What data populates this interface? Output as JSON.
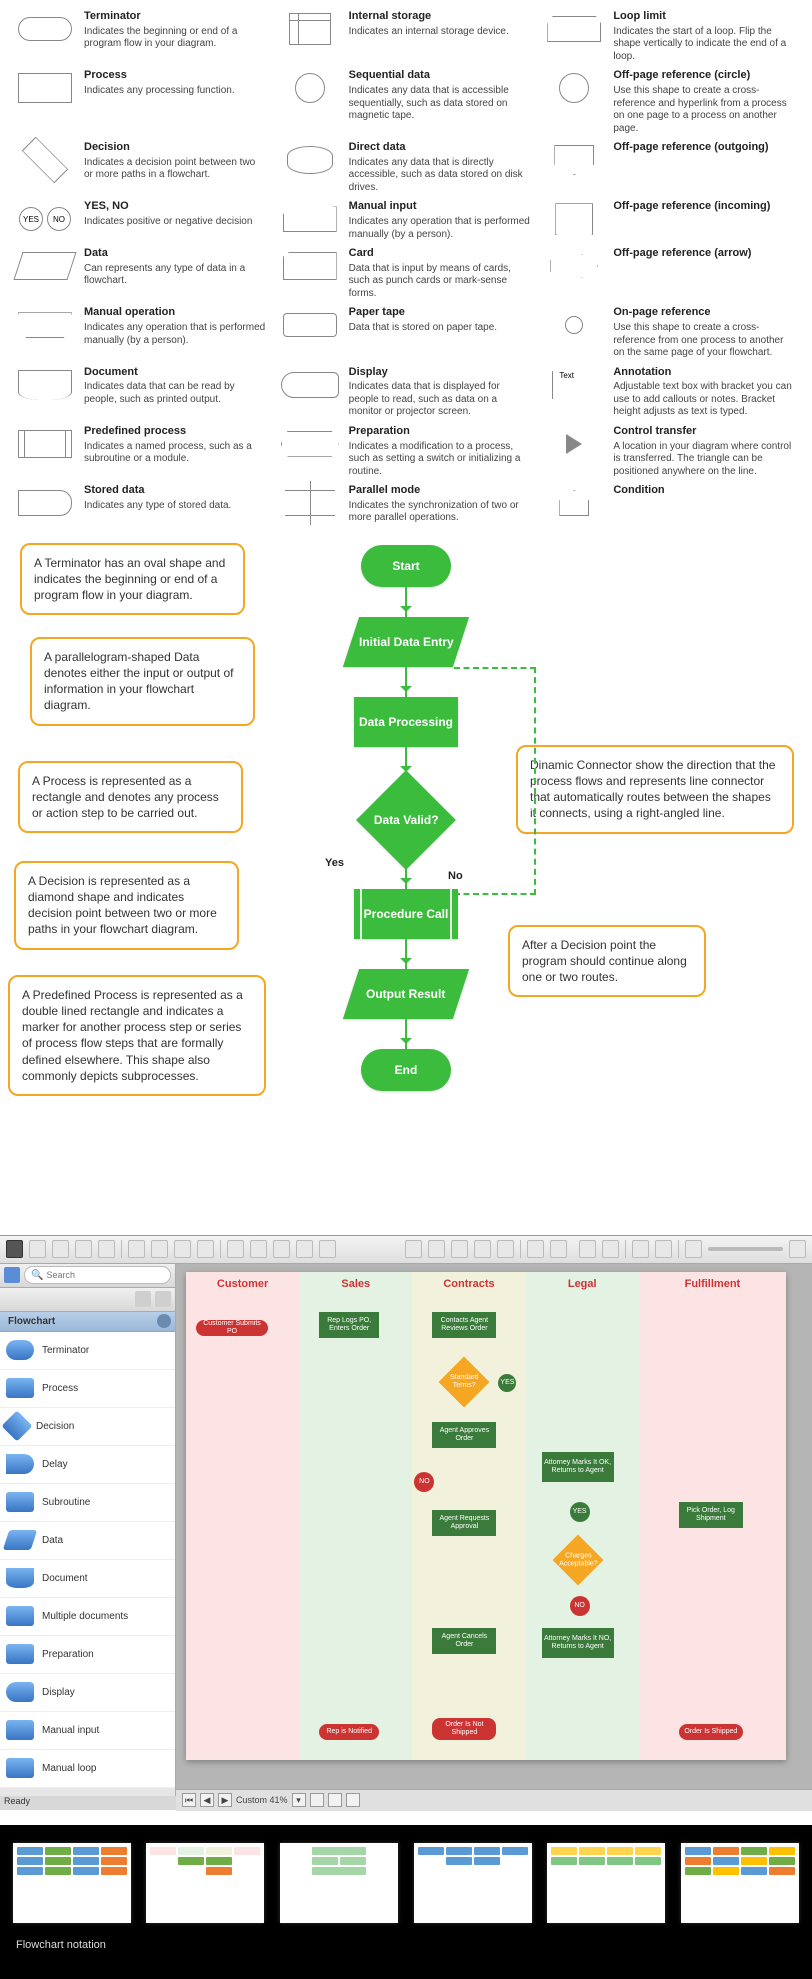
{
  "legend": {
    "col1": [
      {
        "t": "Terminator",
        "d": "Indicates the beginning or end of a program flow in your diagram."
      },
      {
        "t": "Process",
        "d": "Indicates any processing function."
      },
      {
        "t": "Decision",
        "d": "Indicates a decision point between two or more paths in a flowchart."
      },
      {
        "t": "YES, NO",
        "d": "Indicates positive or negative decision"
      },
      {
        "t": "Data",
        "d": "Can represents any type of data in a flowchart."
      },
      {
        "t": "Manual operation",
        "d": "Indicates any operation that is performed manually (by a person)."
      },
      {
        "t": "Document",
        "d": "Indicates data that can be read by people, such as printed output."
      },
      {
        "t": "Predefined process",
        "d": "Indicates a named process, such as a subroutine or a module."
      },
      {
        "t": "Stored data",
        "d": "Indicates any type of stored data."
      }
    ],
    "col2": [
      {
        "t": "Internal storage",
        "d": "Indicates an internal storage device."
      },
      {
        "t": "Sequential data",
        "d": "Indicates any data that is accessible sequentially, such as data stored on magnetic tape."
      },
      {
        "t": "Direct data",
        "d": "Indicates any data that is directly accessible, such as data stored on disk drives."
      },
      {
        "t": "Manual input",
        "d": "Indicates any operation that is performed manually (by a person)."
      },
      {
        "t": "Card",
        "d": "Data that is input by means of cards, such as punch cards or mark-sense forms."
      },
      {
        "t": "Paper tape",
        "d": "Data that is stored on paper tape."
      },
      {
        "t": "Display",
        "d": "Indicates data that is displayed for people to read, such as data on a monitor or projector screen."
      },
      {
        "t": "Preparation",
        "d": "Indicates a modification to a process, such as setting a switch or initializing a routine."
      },
      {
        "t": "Parallel mode",
        "d": "Indicates the synchronization of two or more parallel operations."
      }
    ],
    "col3": [
      {
        "t": "Loop limit",
        "d": "Indicates the start of a loop. Flip the shape vertically to indicate the end of a loop."
      },
      {
        "t": "Off-page reference (circle)",
        "d": "Use this shape to create a cross-reference and hyperlink from a process on one page to a process on another page."
      },
      {
        "t": "Off-page reference (outgoing)",
        "d": ""
      },
      {
        "t": "Off-page reference (incoming)",
        "d": ""
      },
      {
        "t": "Off-page reference (arrow)",
        "d": ""
      },
      {
        "t": "On-page reference",
        "d": "Use this shape to create a cross-reference from one process to another on the same page of your flowchart."
      },
      {
        "t": "Annotation",
        "d": "Adjustable text box with bracket you can use to add callouts or notes. Bracket height adjusts as text is typed."
      },
      {
        "t": "Control transfer",
        "d": "A location in your diagram where control is transferred. The triangle can be positioned anywhere on the line."
      },
      {
        "t": "Condition",
        "d": ""
      }
    ],
    "yes": "YES",
    "no": "NO",
    "text": "Text"
  },
  "callouts": {
    "c1": "A Terminator has an oval shape and indicates the beginning or end of a program flow in your diagram.",
    "c2": "A parallelogram-shaped Data denotes either the input or output of information in your flowchart diagram.",
    "c3": "A Process is represented as a rectangle and denotes any process or action step to be carried out.",
    "c4": "A Decision is represented as a diamond shape and indicates decision point between two or more paths in your flowchart diagram.",
    "c5": "A Predefined Process is represented as a double lined rectangle and indicates a marker for another process step or series of process flow steps that are formally defined elsewhere. This shape also commonly depicts subprocesses.",
    "c6": "Dinamic Connector show the direction that the process flows and represents line connector that automatically routes between the shapes it connects, using a right-angled line.",
    "c7": "After a Decision point the program should continue along one or two routes."
  },
  "flow": {
    "start": "Start",
    "entry": "Initial Data Entry",
    "proc": "Data Processing",
    "valid": "Data Valid?",
    "call": "Procedure Call",
    "out": "Output Result",
    "end": "End",
    "yes": "Yes",
    "no": "No"
  },
  "app": {
    "search_ph": "Search",
    "panel": "Flowchart",
    "items": [
      "Terminator",
      "Process",
      "Decision",
      "Delay",
      "Subroutine",
      "Data",
      "Document",
      "Multiple documents",
      "Preparation",
      "Display",
      "Manual input",
      "Manual loop"
    ],
    "lanes": [
      "Customer",
      "Sales",
      "Contracts",
      "Legal",
      "Fulfillment"
    ],
    "nodes": {
      "n1": "Customer Submits PO",
      "n2": "Rep Logs PO, Enters Order",
      "n3": "Contacts Agent Reviews Order",
      "n4": "Standard Terms?",
      "n5": "YES",
      "n6": "Agent Approves Order",
      "n7": "NO",
      "n8": "Agent Requests Approval",
      "n9": "Attorney Marks It OK, Returns to Agent",
      "n10": "YES",
      "n11": "Charges Acceptable?",
      "n12": "NO",
      "n13": "Agent Cancels Order",
      "n14": "Attorney Marks It NO, Returns to Agent",
      "n15": "Rep is Notified",
      "n16": "Order Is Not Shipped",
      "n17": "Pick Order, Log Shipment",
      "n18": "Order Is Shipped"
    },
    "zoom": "Custom 41%",
    "status": "Ready"
  },
  "gallery": {
    "caption": "Flowchart notation"
  }
}
